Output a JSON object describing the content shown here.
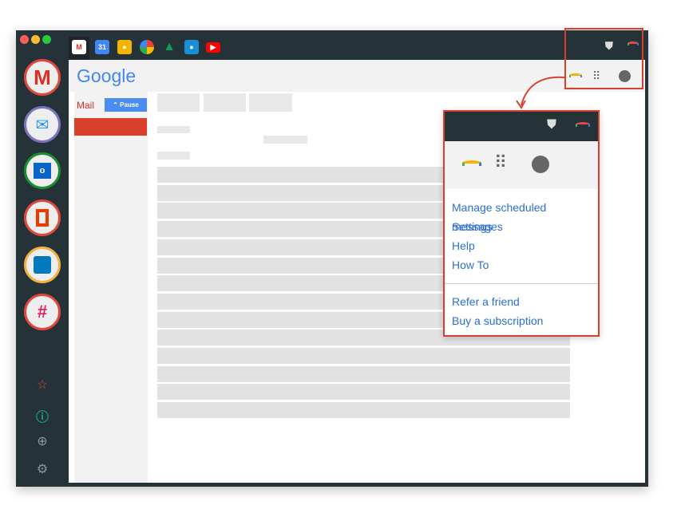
{
  "tabs": [
    {
      "name": "gmail",
      "color": "#d93025"
    },
    {
      "name": "calendar",
      "color": "#4285f4",
      "label": "31"
    },
    {
      "name": "keep",
      "color": "#f4b400"
    },
    {
      "name": "photos",
      "color": "#34a853"
    },
    {
      "name": "drive",
      "color": "#0f9d58"
    },
    {
      "name": "contacts",
      "color": "#1a8fd8"
    },
    {
      "name": "youtube",
      "color": "#ff0000"
    }
  ],
  "apps": [
    {
      "name": "gmail",
      "ring": "#e0483e"
    },
    {
      "name": "inbox",
      "ring": "#7b74c0"
    },
    {
      "name": "outlook",
      "ring": "#1a8f2e"
    },
    {
      "name": "office",
      "ring": "#e0483e"
    },
    {
      "name": "trello",
      "ring": "#f4b040"
    },
    {
      "name": "slack",
      "ring": "#e0483e"
    }
  ],
  "gmail": {
    "logo": "Google",
    "mail_label": "Mail",
    "pause_label": "Pause"
  },
  "menu": {
    "items": [
      "Manage scheduled messages",
      "Settings",
      "Help",
      "How To"
    ],
    "items2": [
      "Refer a friend",
      "Buy a subscription"
    ]
  },
  "colors": {
    "highlight": "#d9402b",
    "link": "#2a6fd1",
    "dark": "#253238"
  }
}
